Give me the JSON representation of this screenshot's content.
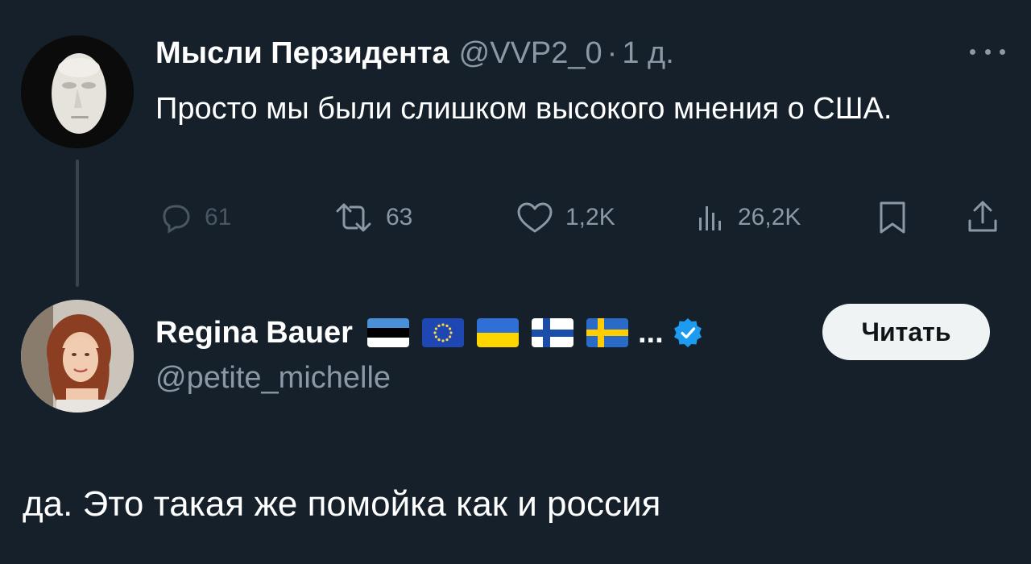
{
  "original_tweet": {
    "display_name": "Мысли Перзидента",
    "handle": "@VVP2_0",
    "separator": "·",
    "time": "1 д.",
    "text": "Просто мы были слишком высокого мнения о США.",
    "actions": {
      "replies": "61",
      "retweets": "63",
      "likes": "1,2K",
      "views": "26,2K"
    },
    "icons": [
      "more-icon",
      "reply-icon",
      "retweet-icon",
      "like-icon",
      "views-icon",
      "bookmark-icon",
      "share-icon"
    ]
  },
  "reply_author": {
    "display_name": "Regina Bauer",
    "flags": [
      "estonia-flag",
      "eu-flag",
      "ukraine-flag",
      "finland-flag",
      "sweden-flag"
    ],
    "ellipsis": "...",
    "verified": true,
    "handle": "@petite_michelle",
    "follow_label": "Читать"
  },
  "reply_text": "да. Это такая же помойка как и россия",
  "colors": {
    "background": "#15202b",
    "text_primary": "#ffffff",
    "text_secondary": "#8b98a5",
    "verified_blue": "#1d9bf0",
    "button_bg": "#eff3f4",
    "thread_line": "#38444d"
  }
}
